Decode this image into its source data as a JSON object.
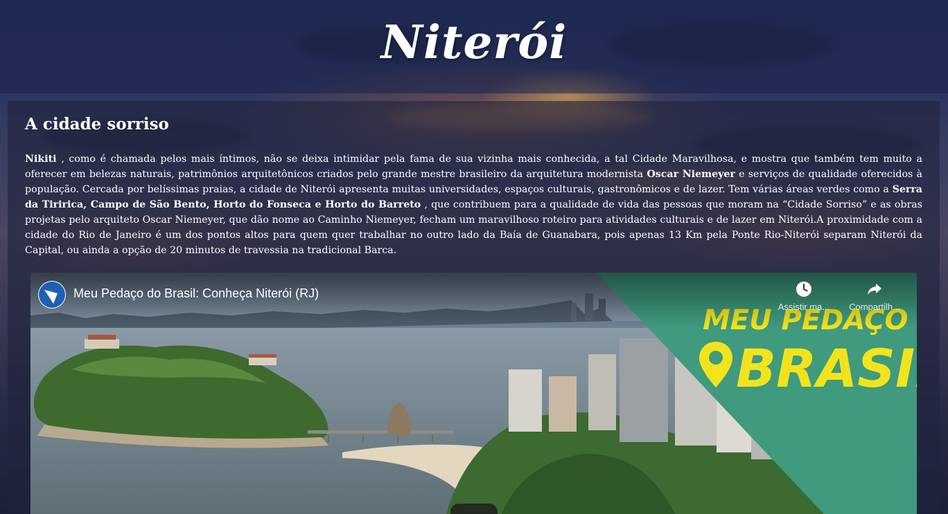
{
  "header": {
    "title": "Niterói"
  },
  "article": {
    "heading": "A cidade sorriso",
    "body": {
      "nikiti": "Nikiti",
      "part1": " , como é chamada pelos mais íntimos, não se deixa intimidar pela fama de sua vizinha mais conhecida, a tal Cidade Maravilhosa, e mostra que também tem muito a oferecer em belezas naturais, patrimônios arquitetônicos criados pelo grande mestre brasileiro da arquitetura modernista ",
      "oscar": "Oscar Niemeyer",
      "part2": " e serviços de qualidade oferecidos à população. Cercada por belíssimas praias, a cidade de Niterói apresenta muitas universidades, espaços culturais, gastronômicos e de lazer. Tem várias áreas verdes como a ",
      "parks": "Serra da Tiririca, Campo de São Bento, Horto do Fonseca e Horto do Barreto",
      "part3": " , que contribuem para a qualidade de vida das pessoas que moram na “Cidade Sorriso” e as obras projetas pelo arquiteto Oscar Niemeyer, que dão nome ao Caminho Niemeyer, fecham um maravilhoso roteiro para atividades culturais e de lazer em Niterói.A proximidade com a cidade do Rio de Janeiro é um dos pontos altos para quem quer trabalhar no outro lado da Baía de Guanabara, pois apenas 13 Km pela Ponte Rio-Niterói separam Niterói da Capital, ou ainda a opção de 20 minutos de travessia na tradicional Barca."
    }
  },
  "video": {
    "title": "Meu Pedaço do Brasil: Conheça Niterói (RJ)",
    "watch_later_label": "Assistir ma...",
    "share_label": "Compartilh...",
    "banner_line1": "MEU PEDAÇO DO",
    "banner_line2": "BRASIL",
    "colors": {
      "banner_green": "#3f9a7e",
      "banner_yellow": "#f2e41c",
      "channel_blue": "#1f5fb4"
    }
  }
}
